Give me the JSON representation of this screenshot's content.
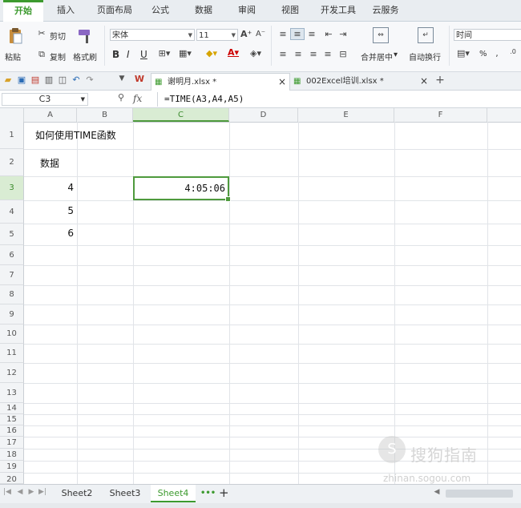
{
  "ribbon_tabs": [
    "开始",
    "插入",
    "页面布局",
    "公式",
    "数据",
    "审阅",
    "视图",
    "开发工具",
    "云服务"
  ],
  "active_tab": "开始",
  "clipboard": {
    "paste": "粘贴",
    "cut": "剪切",
    "copy": "复制",
    "format_painter": "格式刷"
  },
  "font": {
    "name": "宋体",
    "size": "11",
    "bold": "B",
    "italic": "I",
    "underline": "U"
  },
  "alignment": {
    "merge_center": "合并居中",
    "wrap_text": "自动换行"
  },
  "number_format": {
    "value": "时间",
    "percent": "%"
  },
  "quick_access_icons": [
    "folder-open-icon",
    "save-icon",
    "pdf-icon",
    "print-icon",
    "print-preview-icon",
    "undo-icon",
    "redo-icon"
  ],
  "documents": [
    {
      "name": "谢明月.xlsx *",
      "active": true
    },
    {
      "name": "002Excel培训.xlsx *",
      "active": false
    }
  ],
  "formula_bar": {
    "name_box": "C3",
    "fx": "fx",
    "formula": "=TIME(A3,A4,A5)"
  },
  "columns": [
    "A",
    "B",
    "C",
    "D",
    "E",
    "F"
  ],
  "rows": [
    "1",
    "2",
    "3",
    "4",
    "5",
    "6",
    "7",
    "8",
    "9",
    "10",
    "11",
    "12",
    "13",
    "14",
    "15",
    "16",
    "17",
    "18",
    "19",
    "20"
  ],
  "cells": {
    "A1": "如何使用TIME函数",
    "A2": "数据",
    "A3": "4",
    "A4": "5",
    "A5": "6",
    "C3": "4:05:06"
  },
  "selected_cell": "C3",
  "sheets": [
    "Sheet2",
    "Sheet3",
    "Sheet4"
  ],
  "active_sheet": "Sheet4",
  "sheet_more": "•••",
  "sheet_add": "+",
  "watermark": {
    "title": "搜狗指南",
    "url": "zhinan.sogou.com"
  },
  "colors": {
    "accent": "#3c9a2e",
    "selection": "#4e9a3d",
    "header_bg": "#f2f4f6"
  }
}
